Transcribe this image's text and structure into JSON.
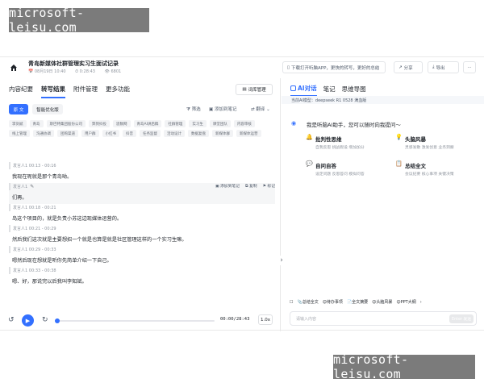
{
  "watermarks": [
    "microsoft-leisu.com",
    "microsoft-leisu.com"
  ],
  "header": {
    "title": "青岛新媒体社群管理实习生面试记录",
    "meta": [
      "08月19日 10:40",
      "0:28:43",
      "6801"
    ],
    "download_banner": "下载打开听脑APP，更快的转写，更好的总结",
    "share_label": "分享",
    "export_label": "导出",
    "more_label": "···"
  },
  "left": {
    "tabs": [
      {
        "label": "内容纪要",
        "active": false
      },
      {
        "label": "转写结果",
        "active": true
      },
      {
        "label": "附件管理",
        "active": false
      },
      {
        "label": "更多功能",
        "active": false
      }
    ],
    "vocab_button": "词库管理",
    "view_original": "原 文",
    "view_optimized": "智能优化版",
    "filter_label": "筛选",
    "add_note_label": "添加到笔记",
    "translate_label": "翻译 ⌄",
    "keywords": [
      "李剑斌",
      "青岛",
      "斯巴特集团股份公司",
      "弊到抖投",
      "思数网",
      "青岛AI讲后稿",
      "社群管理",
      "实习生",
      "课堂团队",
      "内容审核",
      "线上管理",
      "沟通协调",
      "团购渠道",
      "用户群",
      "小红书",
      "抖音",
      "任务监督",
      "活动设计",
      "数据复盘",
      "新媒体群",
      "新媒体运营"
    ],
    "segments": [
      {
        "speaker": "发言人1 00:13 - 00:16",
        "text": "我现在呢就是那个青岛呦。",
        "active": false,
        "edit": false
      },
      {
        "speaker": "发言人1",
        "text": "们再。",
        "active": true,
        "edit": true
      },
      {
        "speaker": "发言人1 00:18 - 00:21",
        "text": "岛这个项目的，就是负责小苏这边现媒体运营的。",
        "active": false,
        "edit": false
      },
      {
        "speaker": "发言人1 00:21 - 00:29",
        "text": "然后我们这次就是主要想招一个就是也算是就是社区管理这样的一个实习生嘛。",
        "active": false,
        "edit": false
      },
      {
        "speaker": "发言人1 00:29 - 00:33",
        "text": "嗯然后现在想就是听你先简单介绍一下自己。",
        "active": false,
        "edit": false
      },
      {
        "speaker": "发言人1 00:33 - 00:38",
        "text": "嗯、好，那说完以后我叫李知斌。",
        "active": false,
        "edit": false
      }
    ],
    "segment_actions": [
      "添加到笔记",
      "复制",
      "标记"
    ],
    "player": {
      "time": "00:00/28:43",
      "speed": "1.0x",
      "progress": 0
    },
    "collapse_label": "›"
  },
  "right": {
    "tabs": [
      {
        "label": "AI对话",
        "active": true
      },
      {
        "label": "笔记",
        "active": false
      },
      {
        "label": "思维导图",
        "active": false
      }
    ],
    "model_bar": "当前AI模型：deepseek R1 0528 满血版",
    "greeting": "我是听脑AI助手，您可以随时向我提问～",
    "cards": [
      {
        "icon": "🔔",
        "title": "批判性思维",
        "desc": "自我反思 挑战假设 增加加分",
        "color": "#f5503c"
      },
      {
        "icon": "💡",
        "title": "头脑风暴",
        "desc": "灵感发散 激发创意 业务洞察",
        "color": "#f6a623"
      },
      {
        "icon": "💬",
        "title": "自问自答",
        "desc": "设定问题 反思答问 模拟问答",
        "color": "#3370ff"
      },
      {
        "icon": "📋",
        "title": "总结全文",
        "desc": "会议纪要 核心事项 关键决策",
        "color": "#22b573"
      }
    ],
    "quick_actions": [
      "☐",
      "📎总结全文",
      "😊待办事项",
      "📄全文摘要",
      "😊头脑风暴",
      "😊PPT大纲",
      "›"
    ],
    "input_placeholder": "请输入内容",
    "send_label": "Enter 发送"
  },
  "colors": {
    "accent": "#3370ff"
  }
}
